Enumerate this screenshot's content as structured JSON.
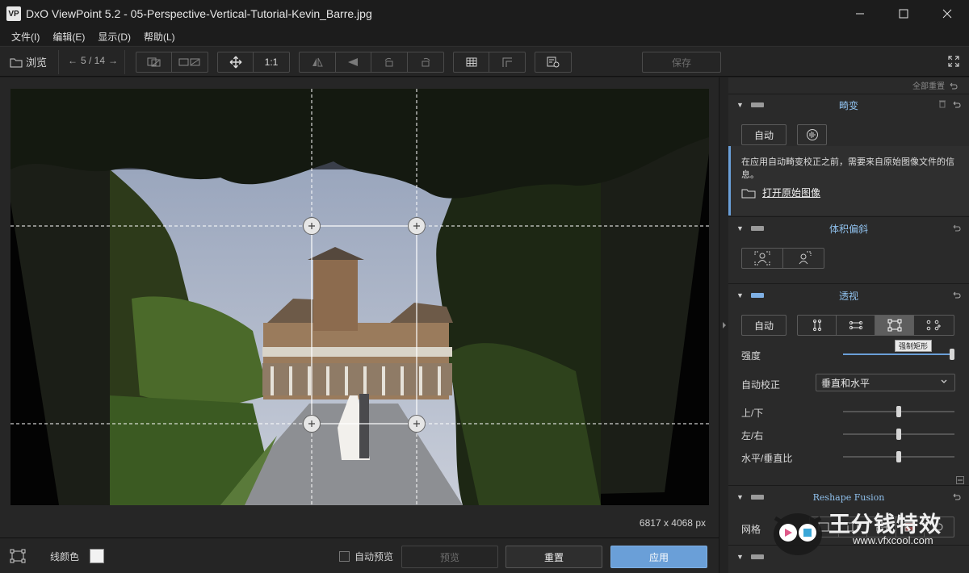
{
  "window": {
    "logo": "VP",
    "title": "DxO ViewPoint 5.2 - 05-Perspective-Vertical-Tutorial-Kevin_Barre.jpg",
    "minimize": "—",
    "maximize": "☐",
    "close": "✕"
  },
  "menu": {
    "items": [
      "文件(I)",
      "编辑(E)",
      "显示(D)",
      "帮助(L)"
    ]
  },
  "toolbar": {
    "browse_label": "浏览",
    "nav_prev": "←",
    "nav_position": "5 / 14",
    "nav_next": "→",
    "zoom_label": "1:1",
    "save_label": "保存"
  },
  "canvas": {
    "dimensions": "6817 x 4068 px"
  },
  "bottombar": {
    "line_color_label": "线颜色",
    "auto_preview_label": "自动预览",
    "preview_label": "预览",
    "reset_label": "重置",
    "apply_label": "应用",
    "colors": {
      "apply_bg": "#6a9fd8",
      "line_swatch": "#f2f2f2"
    }
  },
  "panel": {
    "reset_all": "全部重置",
    "distortion": {
      "title": "畸变",
      "auto_label": "自动",
      "info_text": "在应用自动畸变校正之前，需要来自原始图像文件的信息。",
      "open_original": "打开原始图像"
    },
    "volume": {
      "title": "体积偏斜"
    },
    "perspective": {
      "title": "透视",
      "auto_label": "自动",
      "tooltip": "强制矩形",
      "intensity_label": "强度",
      "auto_correct_label": "自动校正",
      "auto_correct_value": "垂直和水平",
      "updown_label": "上/下",
      "leftright_label": "左/右",
      "ratio_label": "水平/垂直比",
      "intensity_value": 1.0,
      "updown_value": 0.5,
      "leftright_value": 0.5,
      "ratio_value": 0.5
    },
    "reshape": {
      "title": "Reshape Fusion",
      "grid_label": "网格"
    }
  },
  "watermark": {
    "text": "王分钱特效",
    "url": "www.vfxcool.com"
  }
}
